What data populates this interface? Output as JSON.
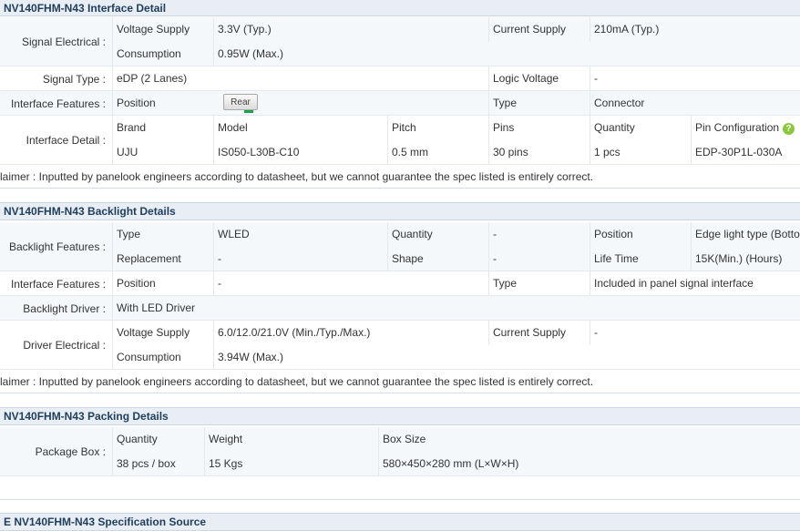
{
  "interface": {
    "title": "NV140FHM-N43 Interface Detail",
    "signal_electrical_label": "Signal Electrical :",
    "voltage_supply_label": "Voltage Supply",
    "voltage_supply_value": "3.3V (Typ.)",
    "current_supply_label": "Current Supply",
    "current_supply_value": "210mA (Typ.)",
    "consumption_label": "Consumption",
    "consumption_value": "0.95W (Max.)",
    "signal_type_label": "Signal Type :",
    "signal_type_value": "eDP (2 Lanes)",
    "logic_voltage_label": "Logic Voltage",
    "logic_voltage_value": "-",
    "features_label": "Interface Features :",
    "position_label": "Position",
    "position_button": "Rear",
    "type_label": "Type",
    "type_value": "Connector",
    "detail_label": "Interface Detail :",
    "detail_headers": [
      "Brand",
      "Model",
      "Pitch",
      "Pins",
      "Quantity",
      "Pin Configuration"
    ],
    "detail_values": [
      "UJU",
      "IS050-L30B-C10",
      "0.5 mm",
      "30 pins",
      "1 pcs",
      "EDP-30P1L-030A"
    ],
    "help_icon": "?",
    "disclaimer": "laimer : Inputted by panelook engineers according to datasheet, but we cannot guarantee the spec listed is entirely correct."
  },
  "backlight": {
    "title": "NV140FHM-N43 Backlight Details",
    "features_label": "Backlight Features :",
    "type_label": "Type",
    "type_value": "WLED",
    "quantity_label": "Quantity",
    "quantity_value": "-",
    "position_label": "Position",
    "position_value": "Edge light type (Botto",
    "replacement_label": "Replacement",
    "replacement_value": "-",
    "shape_label": "Shape",
    "shape_value": "-",
    "life_time_label": "Life Time",
    "life_time_value": "15K(Min.) (Hours)",
    "if_features_label": "Interface Features :",
    "if_position_label": "Position",
    "if_position_value": "-",
    "if_type_label": "Type",
    "if_type_value": "Included in panel signal interface",
    "driver_label": "Backlight Driver :",
    "driver_value": "With LED Driver",
    "driver_electrical_label": "Driver Electrical :",
    "voltage_supply_label": "Voltage Supply",
    "voltage_supply_value": "6.0/12.0/21.0V (Min./Typ./Max.)",
    "current_supply_label": "Current Supply",
    "current_supply_value": "-",
    "consumption_label": "Consumption",
    "consumption_value": "3.94W (Max.)",
    "disclaimer": "laimer : Inputted by panelook engineers according to datasheet, but we cannot guarantee the spec listed is entirely correct."
  },
  "packing": {
    "title": "NV140FHM-N43 Packing Details",
    "package_box_label": "Package Box :",
    "headers": [
      "Quantity",
      "Weight",
      "Box Size"
    ],
    "values": [
      "38 pcs / box",
      "15 Kgs",
      "580×450×280 mm (L×W×H)"
    ]
  },
  "source": {
    "title": "E NV140FHM-N43 Specification Source"
  },
  "colors": {
    "header_bg": "#e8eef4",
    "header_text": "#1f3d5c",
    "row_alt_bg": "#f5f8fb",
    "help_icon": "#8dc63f",
    "rear_indicator": "#1aa34a"
  }
}
